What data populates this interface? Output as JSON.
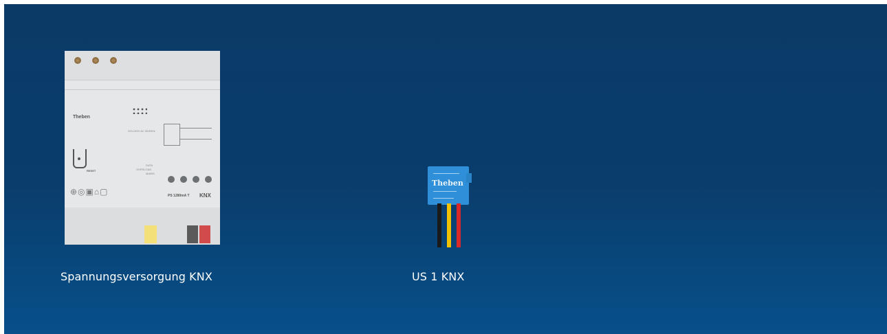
{
  "products": [
    {
      "name": "Spannungsversorgung KNX",
      "image_alt": "Spannungsversorgung KNX device image",
      "device": {
        "brand": "Theben",
        "model": "PS 1280mA T",
        "knx_mark": "KNX",
        "leds": [
          "DATA",
          "OVERLOAD",
          "MAINS"
        ],
        "reset_label": "RESET",
        "power_rating": "220-240V AC  50/60Hz"
      }
    },
    {
      "name": "US 1 KNX",
      "image_alt": "US 1 KNX device image",
      "device": {
        "brand": "Theben",
        "wire_colors": [
          "#1a1a1a",
          "#f2c100",
          "#d82828"
        ]
      }
    }
  ],
  "colors": {
    "panel_top": "#0b3a66",
    "panel_bottom": "#07508a",
    "caption_text": "#ffffff"
  }
}
